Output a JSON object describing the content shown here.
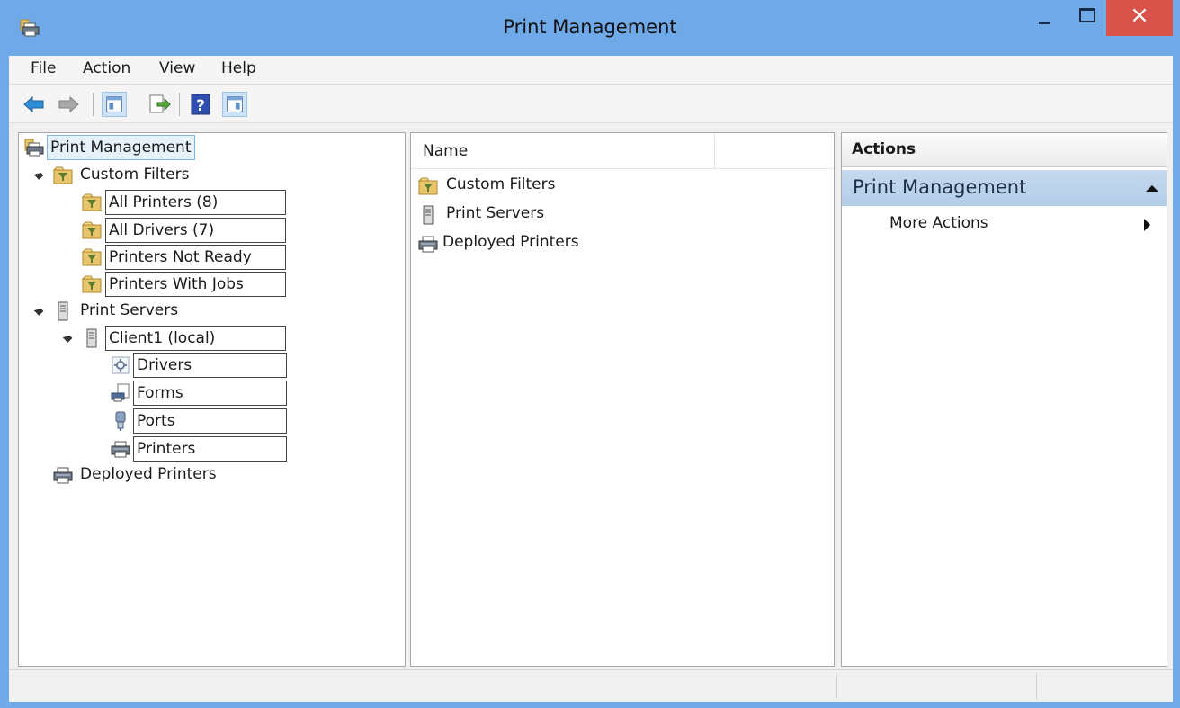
{
  "window": {
    "title": "Print Management",
    "icon": "print-management-icon",
    "accent": "#6fa9e8",
    "close_color": "#d9534a"
  },
  "menu": {
    "file": "File",
    "action": "Action",
    "view": "View",
    "help": "Help"
  },
  "toolbar": [
    "back-arrow-icon",
    "forward-arrow-icon",
    "show-hide-console-tree-icon",
    "export-list-icon",
    "help-icon",
    "show-hide-action-pane-icon"
  ],
  "tree": {
    "root": "Print Management",
    "custom_filters": "Custom Filters",
    "all_printers": "All Printers (8)",
    "all_drivers": "All Drivers (7)",
    "printers_not_ready": "Printers Not Ready",
    "printers_with_jobs": "Printers With Jobs",
    "print_servers": "Print Servers",
    "client1": "Client1 (local)",
    "drivers": "Drivers",
    "forms": "Forms",
    "ports": "Ports",
    "printers": "Printers",
    "deployed_printers": "Deployed Printers"
  },
  "list": {
    "column_name": "Name",
    "items": [
      "Custom Filters",
      "Print Servers",
      "Deployed Printers"
    ]
  },
  "actions": {
    "header": "Actions",
    "section_title": "Print Management",
    "more_actions": "More Actions"
  }
}
